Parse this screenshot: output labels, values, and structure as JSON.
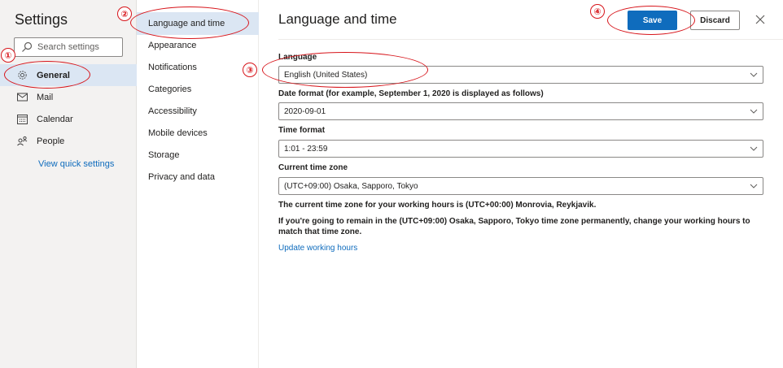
{
  "sidebar": {
    "title": "Settings",
    "search_placeholder": "Search settings",
    "items": [
      {
        "label": "General",
        "icon": "gear-icon"
      },
      {
        "label": "Mail",
        "icon": "mail-icon"
      },
      {
        "label": "Calendar",
        "icon": "calendar-icon"
      },
      {
        "label": "People",
        "icon": "people-icon"
      }
    ],
    "quick_settings_link": "View quick settings",
    "active_index": 0
  },
  "subnav": {
    "items": [
      {
        "label": "Language and time"
      },
      {
        "label": "Appearance"
      },
      {
        "label": "Notifications"
      },
      {
        "label": "Categories"
      },
      {
        "label": "Accessibility"
      },
      {
        "label": "Mobile devices"
      },
      {
        "label": "Storage"
      },
      {
        "label": "Privacy and data"
      }
    ],
    "active_index": 0
  },
  "main": {
    "title": "Language and time",
    "save_label": "Save",
    "discard_label": "Discard",
    "fields": {
      "language": {
        "label": "Language",
        "value": "English (United States)"
      },
      "date_format": {
        "label": "Date format (for example, September 1, 2020 is displayed as follows)",
        "value": "2020-09-01"
      },
      "time_format": {
        "label": "Time format",
        "value": "1:01 - 23:59"
      },
      "time_zone": {
        "label": "Current time zone",
        "value": "(UTC+09:00) Osaka, Sapporo, Tokyo"
      }
    },
    "note_1": "The current time zone for your working hours is (UTC+00:00) Monrovia, Reykjavik.",
    "note_2": "If you're going to remain in the (UTC+09:00) Osaka, Sapporo, Tokyo time zone permanently, change your working hours to match that time zone.",
    "update_link": "Update working hours"
  },
  "annotations": {
    "markers": [
      "①",
      "②",
      "③",
      "④"
    ],
    "color": "#d7141a"
  },
  "colors": {
    "accent": "#0f6cbd",
    "selected_bg": "#dbe6f3",
    "sidebar_bg": "#f3f2f1"
  }
}
